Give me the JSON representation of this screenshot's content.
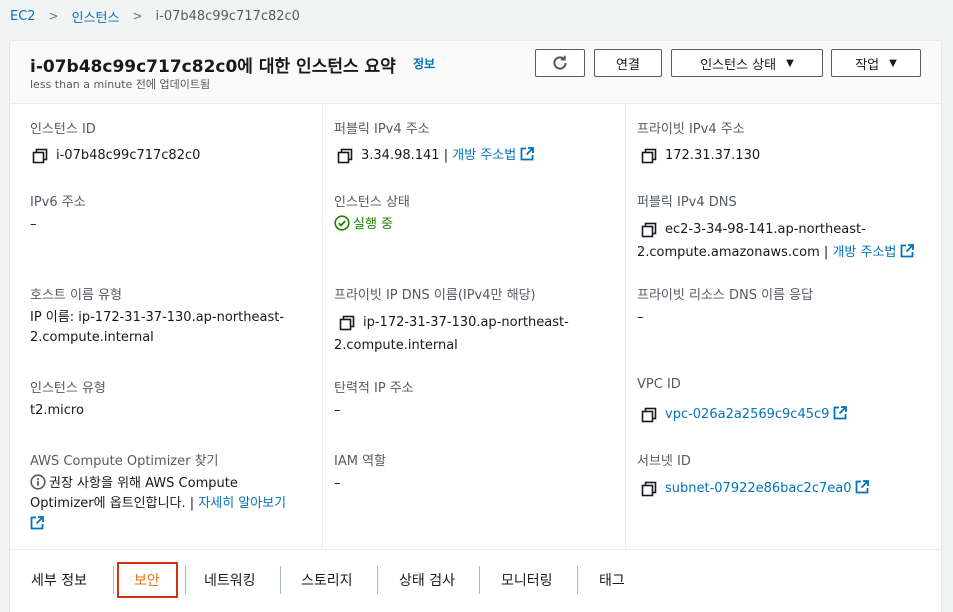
{
  "breadcrumb": {
    "items": [
      "EC2",
      "인스턴스"
    ],
    "current": "i-07b48c99c717c82c0",
    "separator": ">"
  },
  "header": {
    "title": "i-07b48c99c717c82c0에 대한 인스턴스 요약",
    "info": "정보",
    "subtitle": "less than a minute 전에 업데이트됨",
    "buttons": {
      "connect": "연결",
      "instance_state": "인스턴스 상태",
      "actions": "작업"
    }
  },
  "fields": {
    "instance_id": {
      "label": "인스턴스 ID",
      "value": "i-07b48c99c717c82c0"
    },
    "public_ipv4": {
      "label": "퍼블릭 IPv4 주소",
      "value": "3.34.98.141",
      "link": "개방 주소법"
    },
    "private_ipv4": {
      "label": "프라이빗 IPv4 주소",
      "value": "172.31.37.130"
    },
    "ipv6": {
      "label": "IPv6 주소",
      "value": "–"
    },
    "instance_state": {
      "label": "인스턴스 상태",
      "value": "실행 중"
    },
    "public_dns": {
      "label": "퍼블릭 IPv4 DNS",
      "line1": "ec2-3-34-98-141.ap-northeast-",
      "line2": "2.compute.amazonaws.com",
      "link": "개방 주소법"
    },
    "hostname_type": {
      "label": "호스트 이름 유형",
      "line1": "IP 이름: ip-172-31-37-130.ap-northeast-",
      "line2": "2.compute.internal"
    },
    "private_dns": {
      "label": "프라이빗 IP DNS 이름(IPv4만 해당)",
      "line1": "ip-172-31-37-130.ap-northeast-",
      "line2": "2.compute.internal"
    },
    "private_resource_dns": {
      "label": "프라이빗 리소스 DNS 이름 응답",
      "value": "–"
    },
    "instance_type": {
      "label": "인스턴스 유형",
      "value": "t2.micro"
    },
    "elastic_ip": {
      "label": "탄력적 IP 주소",
      "value": "–"
    },
    "vpc_id": {
      "label": "VPC ID",
      "value": "vpc-026a2a2569c9c45c9"
    },
    "compute_optimizer": {
      "label": "AWS Compute Optimizer 찾기",
      "line1": "권장 사항을 위해 AWS Compute",
      "line2": "Optimizer에 옵트인합니다.",
      "link": "자세히 알아보기"
    },
    "iam_role": {
      "label": "IAM 역할",
      "value": "–"
    },
    "subnet_id": {
      "label": "서브넷 ID",
      "value": "subnet-07922e86bac2c7ea0"
    }
  },
  "tabs": [
    "세부 정보",
    "보안",
    "네트워킹",
    "스토리지",
    "상태 검사",
    "모니터링",
    "태그"
  ],
  "active_tab": "보안",
  "colors": {
    "link": "#0073bb",
    "running": "#1d8102",
    "active_tab": "#ec7211",
    "highlight": "#d13212"
  }
}
